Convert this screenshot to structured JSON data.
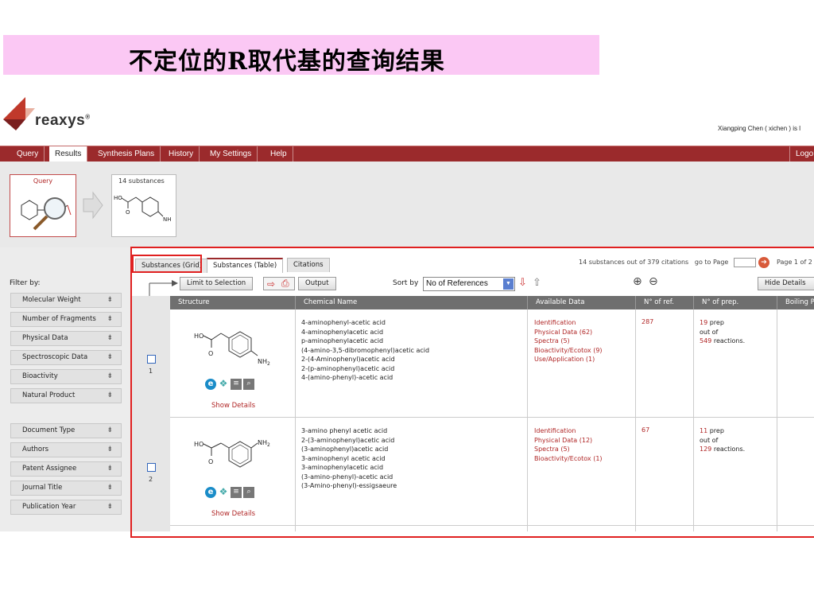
{
  "slide_title": "不定位的R取代基的查询结果",
  "brand": {
    "name": "reaxys",
    "reg": "®"
  },
  "user_line": "Xiangping Chen ( xichen ) is l",
  "nav": {
    "items": [
      "Query",
      "Results",
      "Synthesis Plans",
      "History",
      "My Settings",
      "Help"
    ],
    "active": "Results",
    "logout": "Logo"
  },
  "history": {
    "query_label": "Query",
    "result_label": "14 substances"
  },
  "filter": {
    "title": "Filter by:",
    "group1": [
      "Molecular Weight",
      "Number of Fragments",
      "Physical Data",
      "Spectroscopic Data",
      "Bioactivity",
      "Natural Product"
    ],
    "group2": [
      "Document Type",
      "Authors",
      "Patent Assignee",
      "Journal Title",
      "Publication Year"
    ]
  },
  "tabs": [
    "Substances (Grid)",
    "Substances (Table)",
    "Citations"
  ],
  "active_tab": "Substances (Table)",
  "pager": {
    "summary": "14 substances out of 379 citations",
    "go_to": "go to Page",
    "page_of": "Page 1 of 2"
  },
  "toolbar": {
    "limit": "Limit to Selection",
    "output": "Output",
    "sort_by": "Sort by",
    "sort_value": "No of References",
    "hide_details": "Hide Details"
  },
  "columns": [
    "Structure",
    "Chemical Name",
    "Available Data",
    "N° of ref.",
    "N° of prep.",
    "Boiling Po"
  ],
  "rows": [
    {
      "num": "1",
      "names": [
        "4-aminophenyl-acetic acid",
        "4-aminophenylacetic acid",
        "p-aminophenylacetic acid",
        "(4-amino-3,5-dibromophenyl)acetic acid",
        "2-(4-Aminophenyl)acetic acid",
        "2-(p-aminophenyl)acetic acid",
        "4-(amino-phenyl)-acetic acid"
      ],
      "available": [
        "Identification",
        "Physical Data (62)",
        "Spectra (5)",
        "Bioactivity/Ecotox (9)",
        "Use/Application (1)"
      ],
      "refs": "287",
      "prep_count": "19",
      "prep_label": " prep",
      "out_of": "out of",
      "reactions_count": "549",
      "reactions_label": " reactions.",
      "show_details": "Show Details"
    },
    {
      "num": "2",
      "names": [
        "3-amino phenyl acetic acid",
        "2-(3-aminophenyl)acetic acid",
        "(3-aminophenyl)acetic acid",
        "3-aminophenyl acetic acid",
        "3-aminophenylacetic acid",
        "(3-amino-phenyl)-acetic acid",
        "(3-Amino-phenyl)-essigsaeure"
      ],
      "available": [
        "Identification",
        "Physical Data (12)",
        "Spectra (5)",
        "Bioactivity/Ecotox (1)"
      ],
      "refs": "67",
      "prep_count": "11",
      "prep_label": " prep",
      "out_of": "out of",
      "reactions_count": "129",
      "reactions_label": " reactions.",
      "show_details": "Show Details"
    }
  ],
  "structure_labels": {
    "ho": "HO",
    "o": "O",
    "nh2": "NH",
    "sub2": "2"
  },
  "colors": {
    "brand_red": "#9b2a2c",
    "link_red": "#b02626",
    "highlight": "#e02020",
    "title_bg": "#fbc8f4"
  }
}
